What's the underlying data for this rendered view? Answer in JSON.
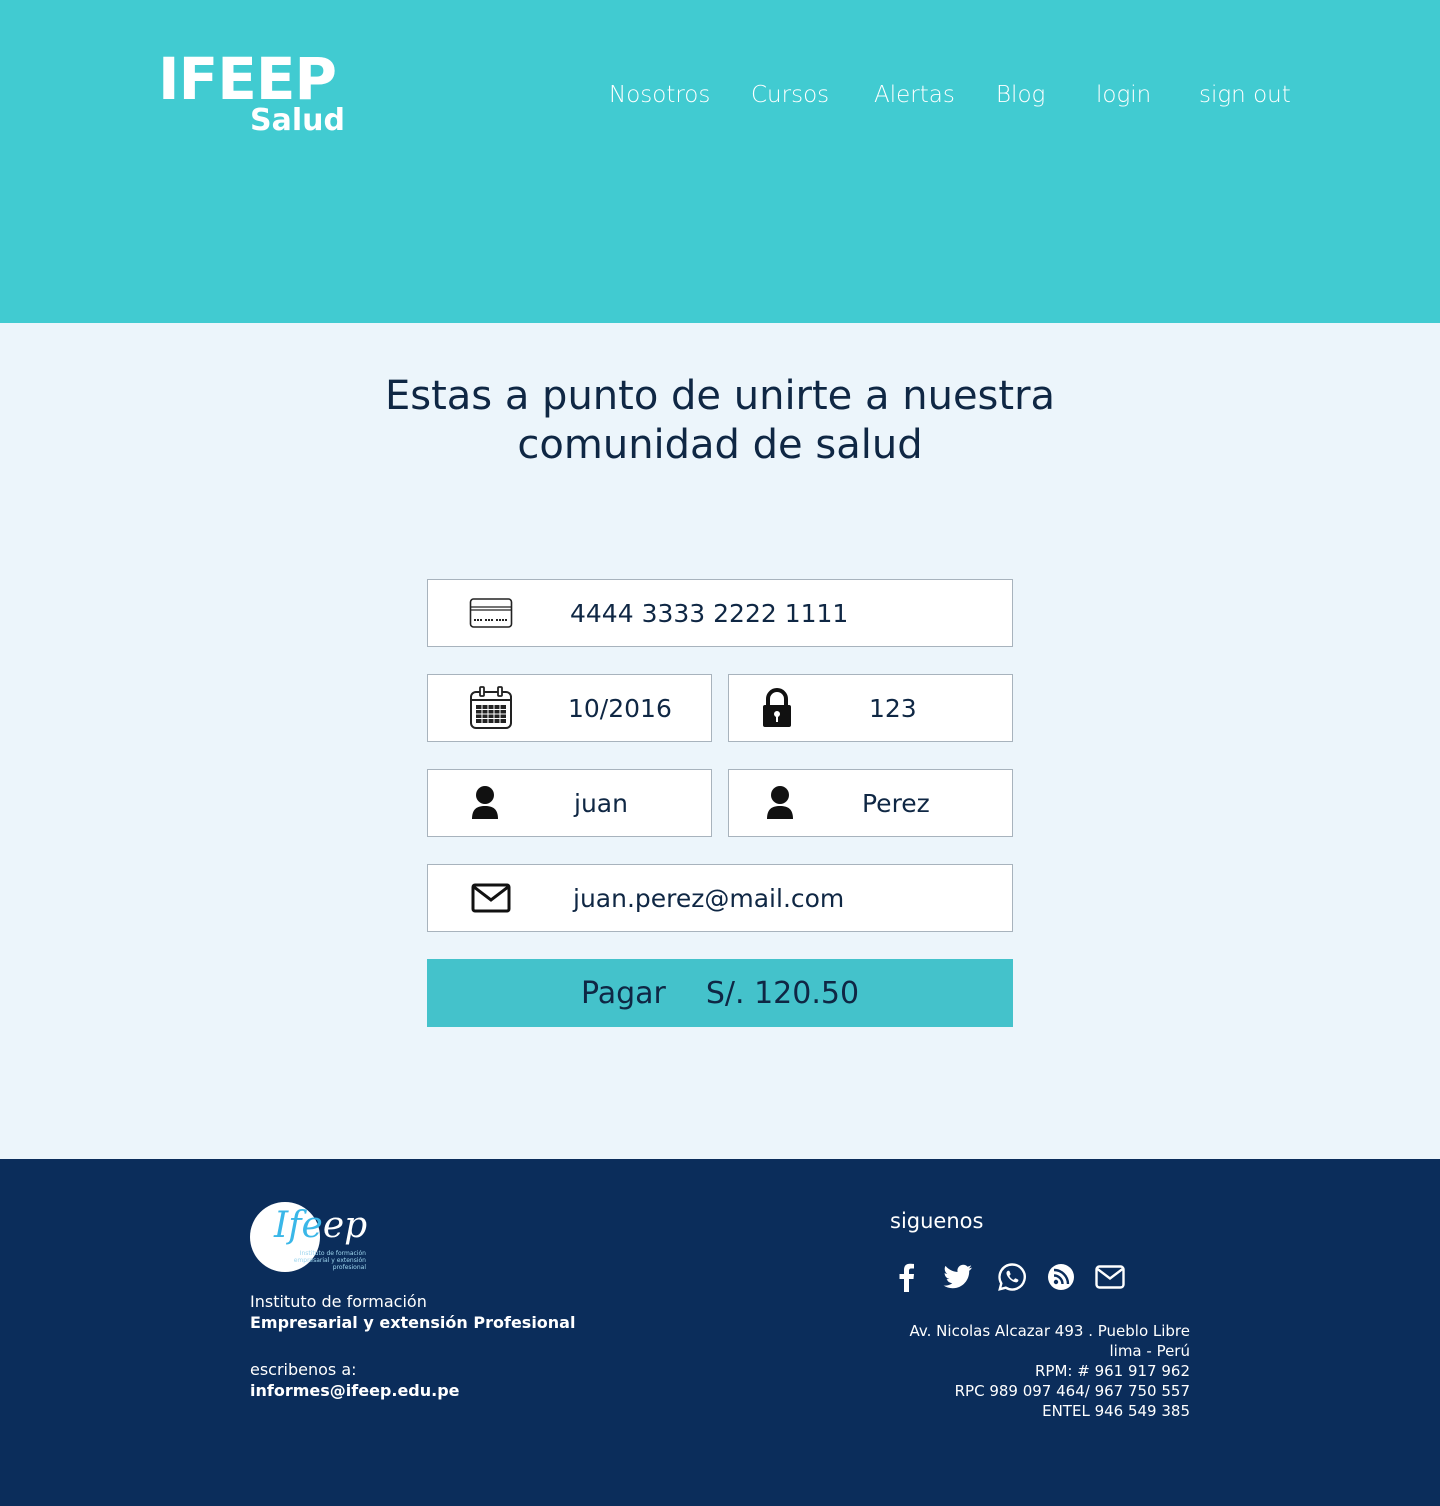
{
  "brand": {
    "name": "IFEEP",
    "sub": "Salud"
  },
  "nav": {
    "nosotros": "Nosotros",
    "cursos": "Cursos",
    "alertas": "Alertas",
    "blog": "Blog",
    "login": "login",
    "signout": "sign out"
  },
  "headline": {
    "line1": "Estas a punto de unirte a nuestra",
    "line2": "comunidad de salud"
  },
  "form": {
    "card_number": "4444 3333 2222 1111",
    "expiry": "10/2016",
    "cvv": "123",
    "first_name": "juan",
    "last_name": "Perez",
    "email": "juan.perez@mail.com",
    "pay_label": "Pagar",
    "pay_amount": "S/. 120.50"
  },
  "footer": {
    "logo_part1": "Ife",
    "logo_part2": "ep",
    "logo_tagline": "Instituto de formación empresarial y extensión profesional",
    "institute_line1": "Instituto de formación",
    "institute_line2": "Empresarial y extensión Profesional",
    "write_label": "escribenos a:",
    "email": "informes@ifeep.edu.pe",
    "follow_label": "siguenos",
    "social_icons": [
      "facebook-icon",
      "twitter-icon",
      "whatsapp-icon",
      "rss-icon",
      "mail-icon"
    ],
    "address_lines": [
      "Av. Nicolas Alcazar 493 . Pueblo Libre",
      "lima - Perú",
      "RPM: # 961 917 962",
      "RPC 989 097 464/ 967 750 557",
      "ENTEL 946 549 385"
    ]
  },
  "colors": {
    "header_bg": "#41cbd1",
    "page_bg": "#ecf5fb",
    "button_bg": "#44c2cb",
    "footer_bg": "#0b2d5b",
    "text_dark": "#0f2744"
  }
}
